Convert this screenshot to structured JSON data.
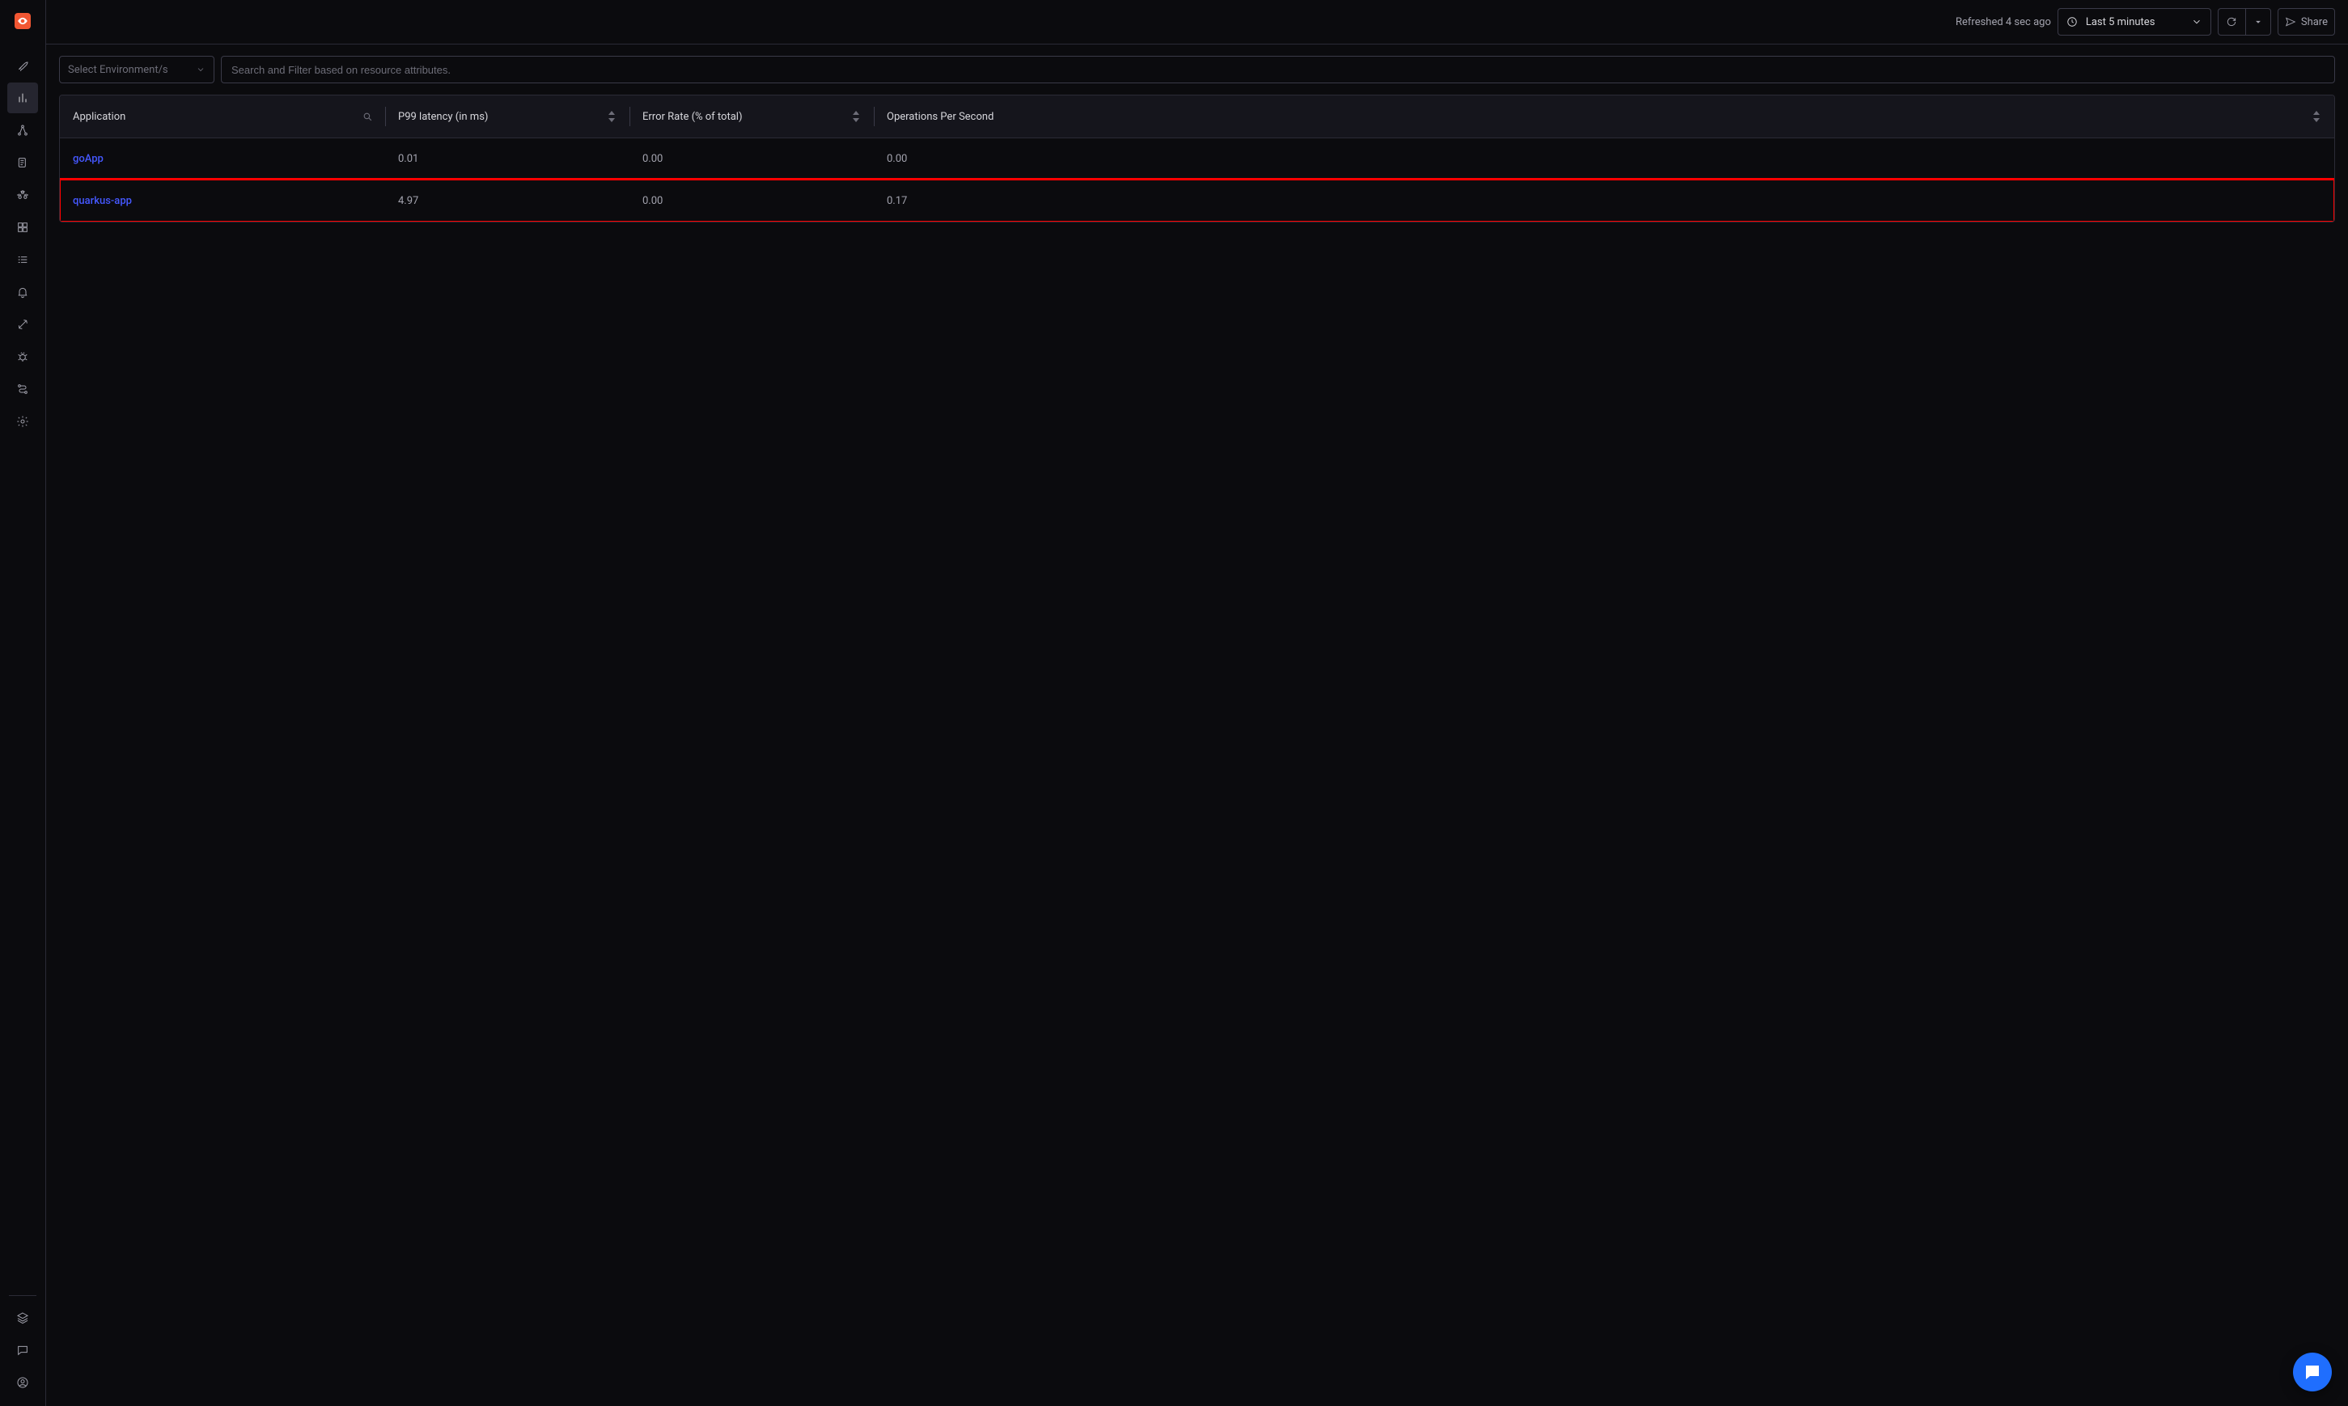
{
  "topbar": {
    "refreshed": "Refreshed 4 sec ago",
    "time_range": "Last 5 minutes",
    "share": "Share"
  },
  "filters": {
    "env_placeholder": "Select Environment/s",
    "search_placeholder": "Search and Filter based on resource attributes."
  },
  "table": {
    "columns": {
      "application": "Application",
      "p99": "P99 latency (in ms)",
      "error_rate": "Error Rate (% of total)",
      "ops": "Operations Per Second"
    },
    "rows": [
      {
        "app": "goApp",
        "p99": "0.01",
        "err": "0.00",
        "ops": "0.00",
        "highlighted": false
      },
      {
        "app": "quarkus-app",
        "p99": "4.97",
        "err": "0.00",
        "ops": "0.17",
        "highlighted": true
      }
    ]
  }
}
